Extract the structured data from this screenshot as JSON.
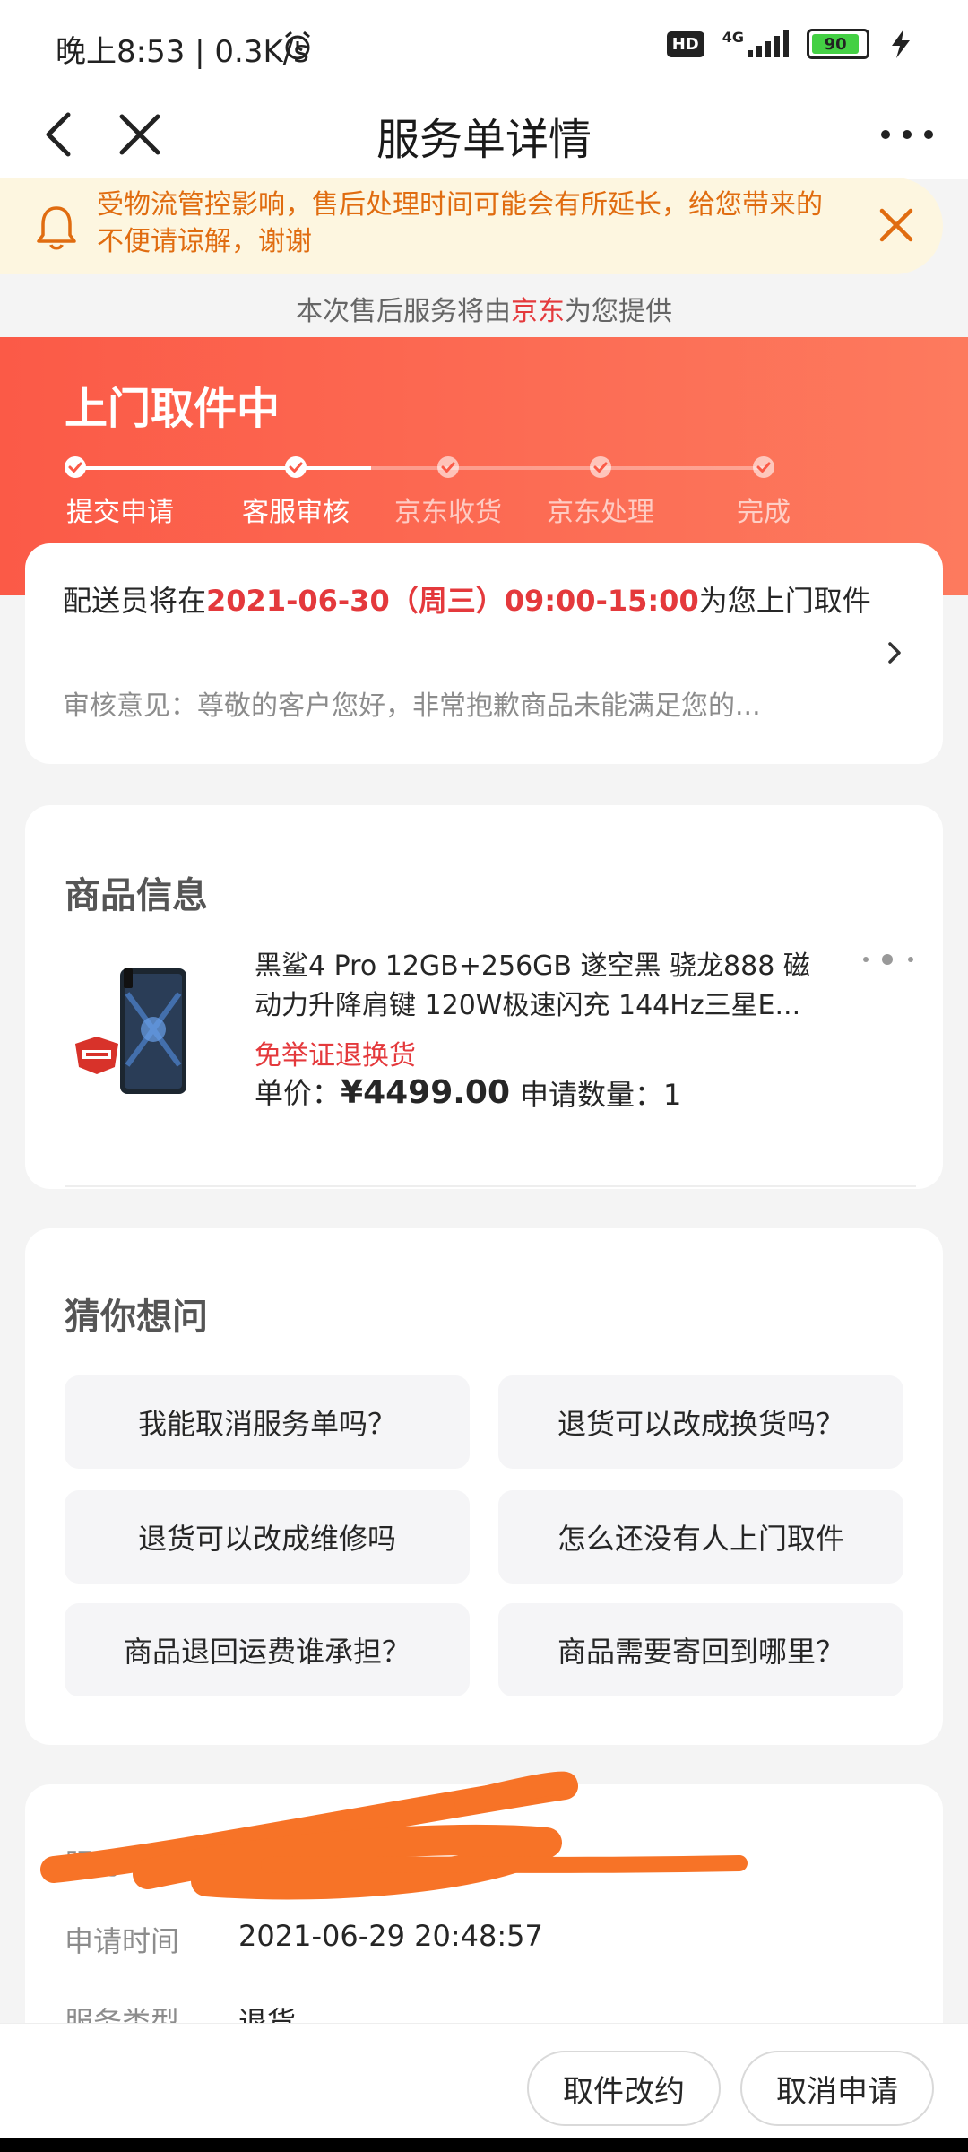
{
  "status_bar": {
    "time_speed": "晚上8:53 | 0.3K/s",
    "network_badge": "HD",
    "network_type": "4G",
    "battery": "90"
  },
  "nav": {
    "title": "服务单详情"
  },
  "notice": {
    "text": "受物流管控影响，售后处理时间可能会有所延长，给您带来的不便请谅解，谢谢"
  },
  "provider": {
    "prefix": "本次售后服务将由",
    "name": "京东",
    "suffix": "为您提供"
  },
  "progress": {
    "status_title": "上门取件中",
    "steps": [
      {
        "label": "提交申请",
        "done": true
      },
      {
        "label": "客服审核",
        "done": true
      },
      {
        "label": "京东收货",
        "done": false
      },
      {
        "label": "京东处理",
        "done": false
      },
      {
        "label": "完成",
        "done": false
      }
    ]
  },
  "pickup": {
    "prefix": "配送员将在",
    "time": "2021-06-30（周三）09:00-15:00",
    "suffix": "为您上门取件",
    "review": "审核意见：尊敬的客户您好，非常抱歉商品未能满足您的..."
  },
  "product": {
    "section_title": "商品信息",
    "name": "黑鲨4 Pro 12GB+256GB 遂空黑 骁龙888 磁动力升降肩键 120W极速闪充 144Hz三星E...",
    "tag": "免举证退换货",
    "price_label": "单价：",
    "price": "¥4499.00",
    "qty_label": "申请数量：",
    "qty": "1"
  },
  "faq": {
    "section_title": "猜你想问",
    "questions": [
      "我能取消服务单吗？",
      "退货可以改成换货吗？",
      "退货可以改成维修吗",
      "怎么还没有人上门取件",
      "商品退回运费谁承担？",
      "商品需要寄回到哪里？"
    ]
  },
  "info": {
    "rows": [
      {
        "label": "服务单号",
        "value": ""
      },
      {
        "label": "申请时间",
        "value": "2021-06-29 20:48:57"
      },
      {
        "label": "服务类型",
        "value": "退货"
      }
    ]
  },
  "actions": {
    "reschedule": "取件改约",
    "cancel": "取消申请"
  },
  "colors": {
    "accent": "#e4393c",
    "banner": "#fb5a47",
    "notice_text": "#e06c10",
    "redaction": "#f77327"
  }
}
